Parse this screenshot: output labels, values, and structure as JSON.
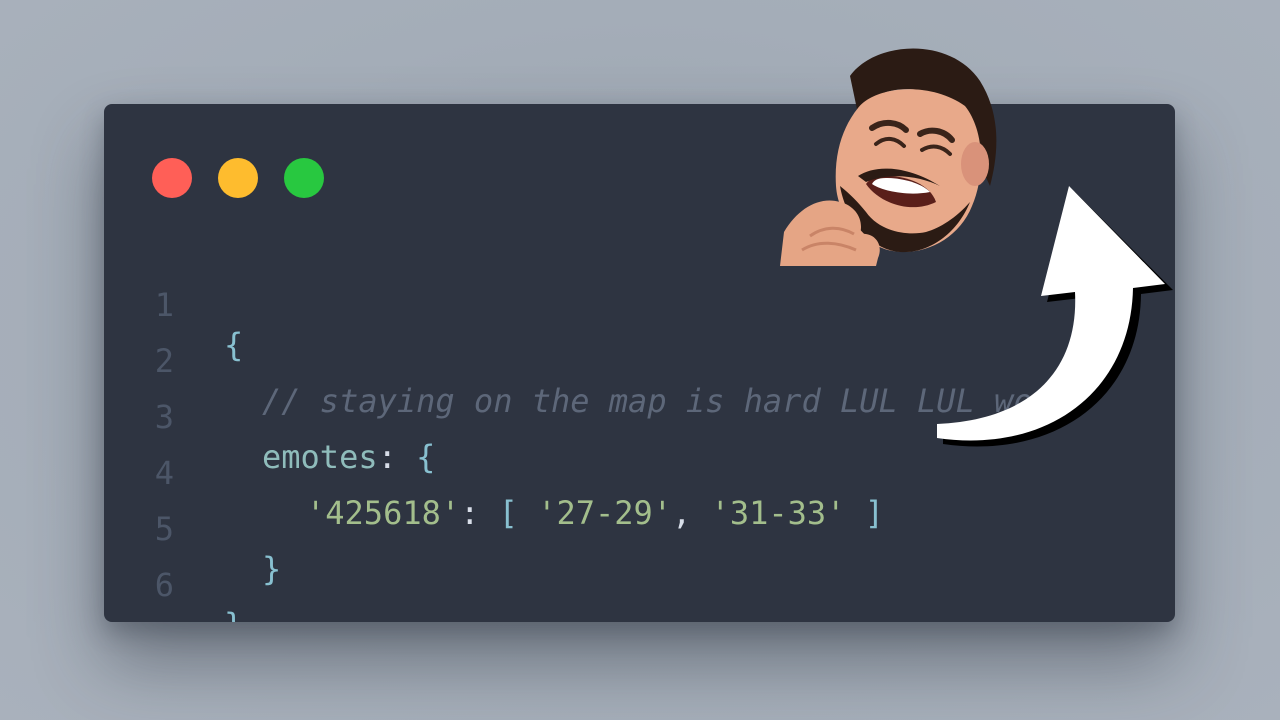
{
  "window": {
    "controls": [
      {
        "name": "close",
        "color": "#ff5f57"
      },
      {
        "name": "minimize",
        "color": "#febc2e"
      },
      {
        "name": "zoom",
        "color": "#28c840"
      }
    ]
  },
  "editor": {
    "lines": [
      {
        "number": "1",
        "text": "{"
      },
      {
        "number": "2",
        "text": "// staying on the map is hard LUL LUL wow"
      },
      {
        "number": "3",
        "key": "emotes",
        "colon": ":",
        "open": "{"
      },
      {
        "number": "4",
        "key": "'425618'",
        "colon": ":",
        "open_bracket": "[",
        "values": [
          "'27-29'",
          "'31-33'"
        ],
        "comma": ",",
        "close_bracket": "]"
      },
      {
        "number": "5",
        "text": "}"
      },
      {
        "number": "6",
        "text": "}"
      }
    ]
  },
  "overlay": {
    "emote_icon": "laughing-face-emote",
    "arrow_icon": "curved-arrow-icon"
  }
}
